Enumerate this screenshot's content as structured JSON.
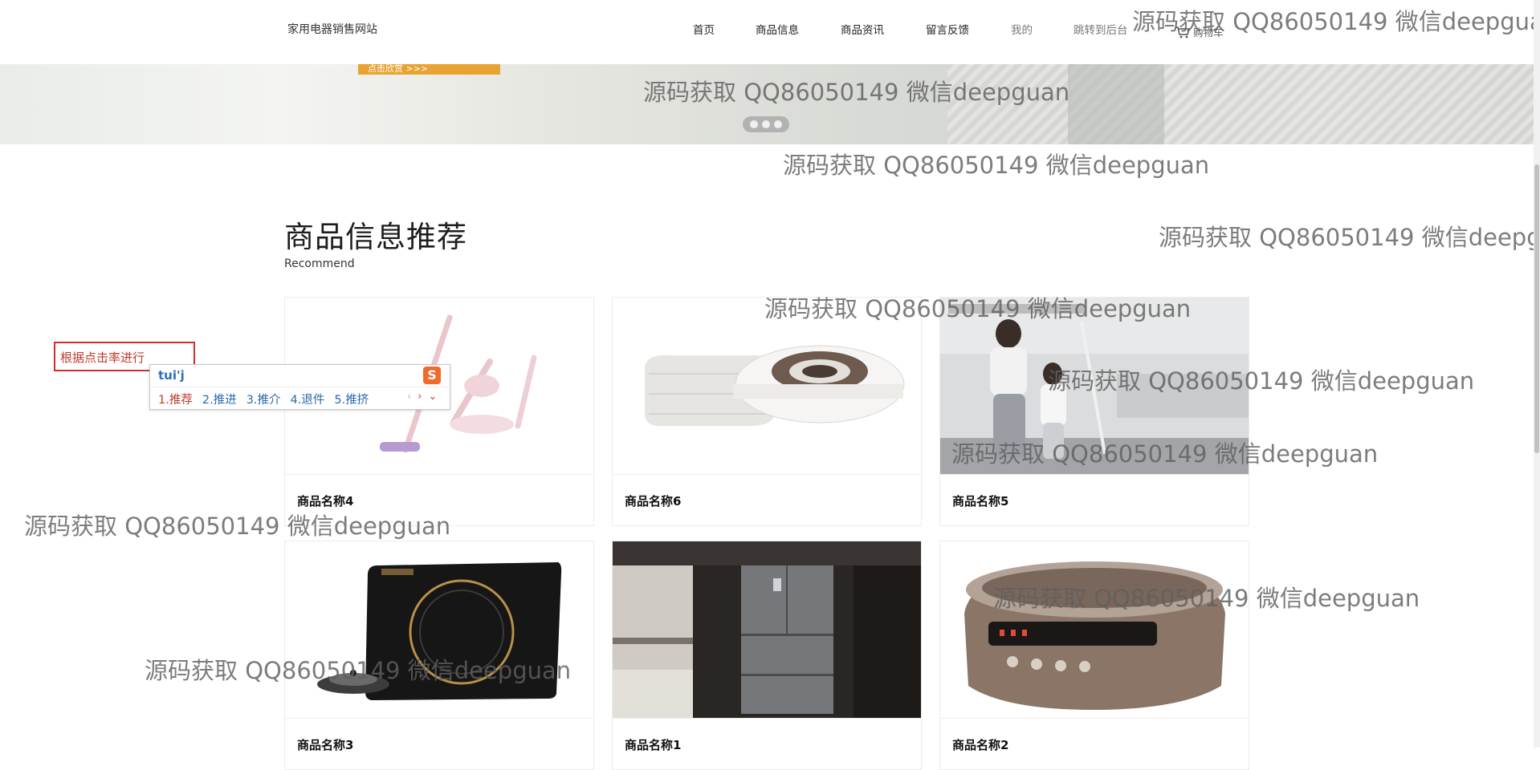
{
  "site": {
    "name": "家用电器销售网站"
  },
  "nav": [
    {
      "label": "首页"
    },
    {
      "label": "商品信息"
    },
    {
      "label": "商品资讯"
    },
    {
      "label": "留言反馈"
    },
    {
      "label": "我的"
    },
    {
      "label": "跳转到后台"
    }
  ],
  "cart": {
    "label": "购物车",
    "icon": "cart-icon"
  },
  "banner": {
    "button_label": "点击欣赏 >>>",
    "active_slide": 1,
    "slide_count": 3
  },
  "section": {
    "title": "商品信息推荐",
    "subtitle": "Recommend"
  },
  "products": [
    {
      "name": "商品名称4"
    },
    {
      "name": "商品名称6"
    },
    {
      "name": "商品名称5"
    },
    {
      "name": "商品名称3"
    },
    {
      "name": "商品名称1"
    },
    {
      "name": "商品名称2"
    }
  ],
  "hint": {
    "text": "根据点击率进行"
  },
  "ime": {
    "composition": "tui'j",
    "candidates": [
      "1.推荐",
      "2.推进",
      "3.推介",
      "4.退件",
      "5.推挤"
    ],
    "logo": "S"
  },
  "watermark": {
    "text": "源码获取 QQ86050149 微信deepguan"
  },
  "colors": {
    "accent_red": "#d72a2a",
    "ime_blue": "#2b6cc4",
    "banner_button": "#e8a331"
  }
}
